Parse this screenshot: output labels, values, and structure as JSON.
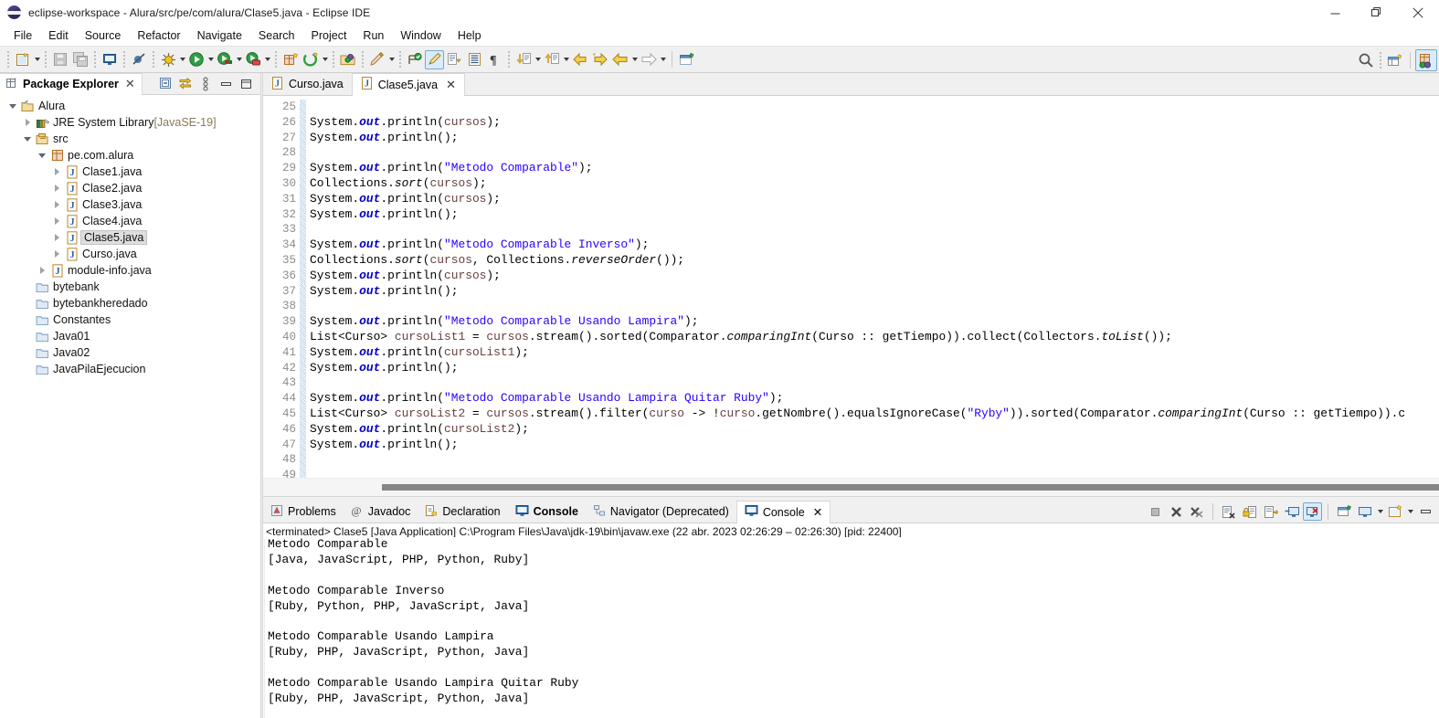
{
  "window": {
    "title": "eclipse-workspace - Alura/src/pe/com/alura/Clase5.java - Eclipse IDE",
    "logo_icon": "eclipse-logo-icon",
    "minimize_label": "—",
    "restore_label": "❐",
    "close_label": "✕"
  },
  "menubar": {
    "items": [
      {
        "label": "File"
      },
      {
        "label": "Edit"
      },
      {
        "label": "Source"
      },
      {
        "label": "Refactor"
      },
      {
        "label": "Navigate"
      },
      {
        "label": "Search"
      },
      {
        "label": "Project"
      },
      {
        "label": "Run"
      },
      {
        "label": "Window"
      },
      {
        "label": "Help"
      }
    ]
  },
  "toolbar": {
    "icons": [
      "new-wizard-icon",
      "save-icon",
      "save-all-icon",
      "console-view-icon",
      "skip-breakpoints-icon",
      "debug-icon",
      "run-icon",
      "coverage-icon",
      "external-tools-icon",
      "new-java-package-icon",
      "new-java-class-icon",
      "open-type-icon",
      "search-icon",
      "perspective-open-icon",
      "java-perspective-icon"
    ],
    "search_icon": "search-icon",
    "perspective_icon": "java-perspective-icon"
  },
  "package_explorer": {
    "tab_label": "Package Explorer",
    "tab_icon": "package-explorer-icon",
    "close_icon": "close-icon",
    "tools": [
      "collapse-all-icon",
      "link-with-editor-icon",
      "view-menu-icon",
      "minimize-icon",
      "maximize-icon"
    ],
    "tree": [
      {
        "label": "Alura",
        "depth": 0,
        "twisty": "down",
        "icon": "java-project-icon",
        "selected": false,
        "suffix": ""
      },
      {
        "label": "JRE System Library",
        "depth": 1,
        "twisty": "right",
        "icon": "library-icon",
        "selected": false,
        "suffix": "[JavaSE-19]"
      },
      {
        "label": "src",
        "depth": 1,
        "twisty": "down",
        "icon": "source-folder-icon",
        "selected": false,
        "suffix": ""
      },
      {
        "label": "pe.com.alura",
        "depth": 2,
        "twisty": "down",
        "icon": "package-icon",
        "selected": false,
        "suffix": ""
      },
      {
        "label": "Clase1.java",
        "depth": 3,
        "twisty": "right",
        "icon": "java-file-icon",
        "selected": false,
        "suffix": ""
      },
      {
        "label": "Clase2.java",
        "depth": 3,
        "twisty": "right",
        "icon": "java-file-icon",
        "selected": false,
        "suffix": ""
      },
      {
        "label": "Clase3.java",
        "depth": 3,
        "twisty": "right",
        "icon": "java-file-icon",
        "selected": false,
        "suffix": ""
      },
      {
        "label": "Clase4.java",
        "depth": 3,
        "twisty": "right",
        "icon": "java-file-icon",
        "selected": false,
        "suffix": ""
      },
      {
        "label": "Clase5.java",
        "depth": 3,
        "twisty": "right",
        "icon": "java-file-icon",
        "selected": true,
        "suffix": ""
      },
      {
        "label": "Curso.java",
        "depth": 3,
        "twisty": "right",
        "icon": "java-file-icon",
        "selected": false,
        "suffix": ""
      },
      {
        "label": "module-info.java",
        "depth": 2,
        "twisty": "right",
        "icon": "java-file-icon",
        "selected": false,
        "suffix": ""
      },
      {
        "label": "bytebank",
        "depth": 1,
        "twisty": "none",
        "icon": "folder-icon",
        "selected": false,
        "suffix": ""
      },
      {
        "label": "bytebankheredado",
        "depth": 1,
        "twisty": "none",
        "icon": "folder-icon",
        "selected": false,
        "suffix": ""
      },
      {
        "label": "Constantes",
        "depth": 1,
        "twisty": "none",
        "icon": "folder-icon",
        "selected": false,
        "suffix": ""
      },
      {
        "label": "Java01",
        "depth": 1,
        "twisty": "none",
        "icon": "folder-icon",
        "selected": false,
        "suffix": ""
      },
      {
        "label": "Java02",
        "depth": 1,
        "twisty": "none",
        "icon": "folder-icon",
        "selected": false,
        "suffix": ""
      },
      {
        "label": "JavaPilaEjecucion",
        "depth": 1,
        "twisty": "none",
        "icon": "folder-icon",
        "selected": false,
        "suffix": ""
      }
    ]
  },
  "editor": {
    "tabs": [
      {
        "label": "Curso.java",
        "icon": "java-file-icon",
        "active": false,
        "closable": false
      },
      {
        "label": "Clase5.java",
        "icon": "java-file-icon",
        "active": true,
        "closable": true
      }
    ],
    "first_line_number": 25,
    "last_line_number": 49,
    "lines": [
      {
        "n": 25,
        "html": ""
      },
      {
        "n": 26,
        "html": "System.<span class=\"kw-field\">out</span>.println(<span class=\"lvar\">cursos</span>);"
      },
      {
        "n": 27,
        "html": "System.<span class=\"kw-field\">out</span>.println();"
      },
      {
        "n": 28,
        "html": ""
      },
      {
        "n": 29,
        "html": "System.<span class=\"kw-field\">out</span>.println(<span class=\"str\">\"Metodo Comparable\"</span>);"
      },
      {
        "n": 30,
        "html": "Collections.<span class=\"mth-it\">sort</span>(<span class=\"lvar\">cursos</span>);"
      },
      {
        "n": 31,
        "html": "System.<span class=\"kw-field\">out</span>.println(<span class=\"lvar\">cursos</span>);"
      },
      {
        "n": 32,
        "html": "System.<span class=\"kw-field\">out</span>.println();"
      },
      {
        "n": 33,
        "html": ""
      },
      {
        "n": 34,
        "html": "System.<span class=\"kw-field\">out</span>.println(<span class=\"str\">\"Metodo Comparable Inverso\"</span>);"
      },
      {
        "n": 35,
        "html": "Collections.<span class=\"mth-it\">sort</span>(<span class=\"lvar\">cursos</span>, Collections.<span class=\"mth-it\">reverseOrder</span>());"
      },
      {
        "n": 36,
        "html": "System.<span class=\"kw-field\">out</span>.println(<span class=\"lvar\">cursos</span>);"
      },
      {
        "n": 37,
        "html": "System.<span class=\"kw-field\">out</span>.println();"
      },
      {
        "n": 38,
        "html": ""
      },
      {
        "n": 39,
        "html": "System.<span class=\"kw-field\">out</span>.println(<span class=\"str\">\"Metodo Comparable Usando Lampira\"</span>);"
      },
      {
        "n": 40,
        "html": "List&lt;Curso&gt; <span class=\"lvar\">cursoList1</span> = <span class=\"lvar\">cursos</span>.stream().sorted(Comparator.<span class=\"mth-it\">comparingInt</span>(Curso :: getTiempo)).collect(Collectors.<span class=\"mth-it\">toList</span>());"
      },
      {
        "n": 41,
        "html": "System.<span class=\"kw-field\">out</span>.println(<span class=\"lvar\">cursoList1</span>);"
      },
      {
        "n": 42,
        "html": "System.<span class=\"kw-field\">out</span>.println();"
      },
      {
        "n": 43,
        "html": ""
      },
      {
        "n": 44,
        "html": "System.<span class=\"kw-field\">out</span>.println(<span class=\"str\">\"Metodo Comparable Usando Lampira Quitar Ruby\"</span>);"
      },
      {
        "n": 45,
        "html": "List&lt;Curso&gt; <span class=\"lvar\">cursoList2</span> = <span class=\"lvar\">cursos</span>.stream().filter(<span class=\"lvar\">curso</span> -&gt; !<span class=\"lvar\">curso</span>.getNombre().equalsIgnoreCase(<span class=\"str\">\"Ryby\"</span>)).sorted(Comparator.<span class=\"mth-it\">comparingInt</span>(Curso :: getTiempo)).c"
      },
      {
        "n": 46,
        "html": "System.<span class=\"kw-field\">out</span>.println(<span class=\"lvar\">cursoList2</span>);"
      },
      {
        "n": 47,
        "html": "System.<span class=\"kw-field\">out</span>.println();"
      },
      {
        "n": 48,
        "html": ""
      },
      {
        "n": 49,
        "html": ""
      }
    ]
  },
  "console_panel": {
    "tabs": [
      {
        "label": "Problems",
        "icon": "problems-icon",
        "active": false,
        "bold": false,
        "closable": false
      },
      {
        "label": "Javadoc",
        "icon": "javadoc-icon",
        "active": false,
        "bold": false,
        "closable": false
      },
      {
        "label": "Declaration",
        "icon": "declaration-icon",
        "active": false,
        "bold": false,
        "closable": false
      },
      {
        "label": "Console",
        "icon": "console-icon",
        "active": false,
        "bold": true,
        "closable": false
      },
      {
        "label": "Navigator (Deprecated)",
        "icon": "navigator-icon",
        "active": false,
        "bold": false,
        "closable": false
      },
      {
        "label": "Console",
        "icon": "console-icon",
        "active": true,
        "bold": false,
        "closable": true
      }
    ],
    "close_icon": "close-icon",
    "tools": [
      "terminate-icon",
      "remove-launch-icon",
      "remove-all-terminated-icon",
      "clear-console-icon",
      "scroll-lock-icon",
      "word-wrap-icon",
      "show-console-on-output-icon",
      "pin-console-icon",
      "new-console-view-icon",
      "display-selected-console-icon",
      "open-console-menu-icon",
      "minimize-icon"
    ],
    "status_line": "<terminated> Clase5 [Java Application] C:\\Program Files\\Java\\jdk-19\\bin\\javaw.exe  (22 abr. 2023 02:26:29 – 02:26:30) [pid: 22400]",
    "output": "Metodo Comparable\n[Java, JavaScript, PHP, Python, Ruby]\n\nMetodo Comparable Inverso\n[Ruby, Python, PHP, JavaScript, Java]\n\nMetodo Comparable Usando Lampira\n[Ruby, PHP, JavaScript, Python, Java]\n\nMetodo Comparable Usando Lampira Quitar Ruby\n[Ruby, PHP, JavaScript, Python, Java]\n"
  },
  "colors": {
    "toolbar_bg": "#f0f0f0",
    "editor_bg": "#ffffff",
    "selection_bg": "#dedede",
    "string_fg": "#2a00ff",
    "field_fg": "#0000c0",
    "local_var_fg": "#6a3e3e",
    "line_number_fg": "#8c8c8c",
    "accent_blue": "#3a76c4"
  }
}
